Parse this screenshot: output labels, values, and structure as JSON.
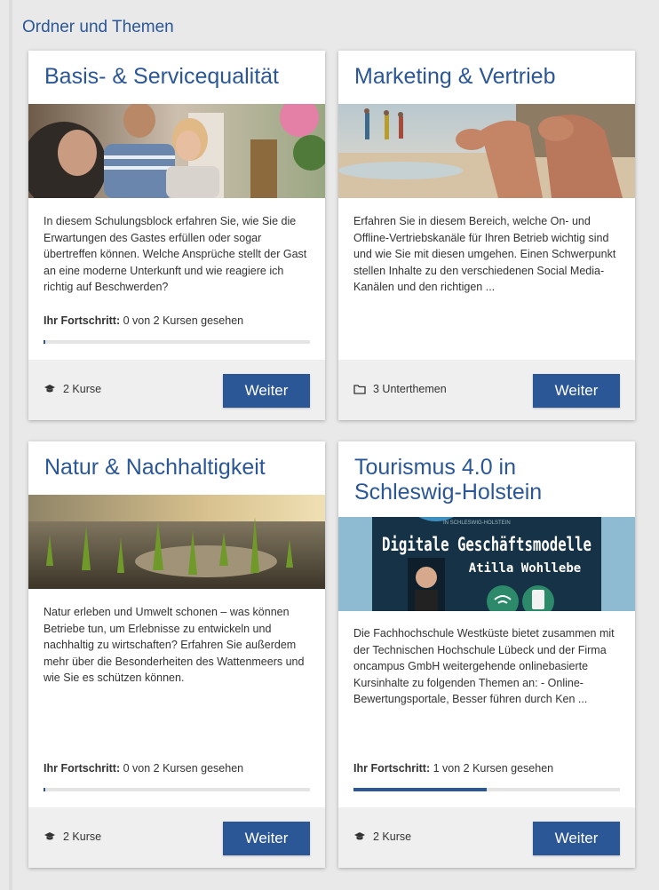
{
  "section": {
    "title": "Ordner und Themen"
  },
  "cards": [
    {
      "title": "Basis- & Servicequalität",
      "description": "In diesem Schulungsblock erfahren Sie, wie Sie die Erwartungen des Gastes erfüllen oder sogar übertreffen können. Welche Ansprüche stellt der Gast an eine moderne Unterkunft und wie reagiere ich richtig auf Beschwerden?",
      "progress_label": "Ihr Fortschritt:",
      "progress_text": "0 von 2 Kursen gesehen",
      "progress_fraction": 0.0,
      "meta_icon": "graduation-cap-icon",
      "meta_text": "2 Kurse",
      "button": "Weiter"
    },
    {
      "title": "Marketing & Vertrieb",
      "description": "Erfahren Sie in diesem Bereich, welche On- und Offline-Vertriebskanäle für Ihren Betrieb wichtig sind und wie Sie mit diesen umgehen. Einen Schwerpunkt stellen Inhalte zu den verschiedenen Social Media-Kanälen und den richtigen ...",
      "meta_icon": "folder-icon",
      "meta_text": "3 Unterthemen",
      "button": "Weiter"
    },
    {
      "title": "Natur & Nachhaltigkeit",
      "description": "Natur erleben und Umwelt schonen – was können Betriebe tun, um Erlebnisse zu entwickeln und nachhaltig zu wirtschaften? Erfahren Sie außerdem mehr über die Besonderheiten des Wattenmeers und wie Sie es schützen können.",
      "progress_label": "Ihr Fortschritt:",
      "progress_text": "0 von 2 Kursen gesehen",
      "progress_fraction": 0.0,
      "meta_icon": "graduation-cap-icon",
      "meta_text": "2 Kurse",
      "button": "Weiter"
    },
    {
      "title": "Tourismus 4.0 in Schleswig-Holstein",
      "image_small_text": "IN SCHLESWIG-HOLSTEIN",
      "image_headline": "Digitale Geschäftsmodelle",
      "image_name": "Atilla Wohllebe",
      "description": "Die Fachhochschule Westküste bietet zusammen mit der Technischen Hochschule Lübeck und der Firma oncampus GmbH weitergehende onlinebasierte Kursinhalte zu folgenden Themen an: - Online-Bewertungsportale, Besser führen durch Ken ...",
      "progress_label": "Ihr Fortschritt:",
      "progress_text": "1 von 2 Kursen gesehen",
      "progress_fraction": 0.5,
      "meta_icon": "graduation-cap-icon",
      "meta_text": "2 Kurse",
      "button": "Weiter"
    }
  ],
  "colors": {
    "accent": "#2b5797",
    "footer_bg": "#efefef",
    "page_bg": "#e9e9e9"
  }
}
